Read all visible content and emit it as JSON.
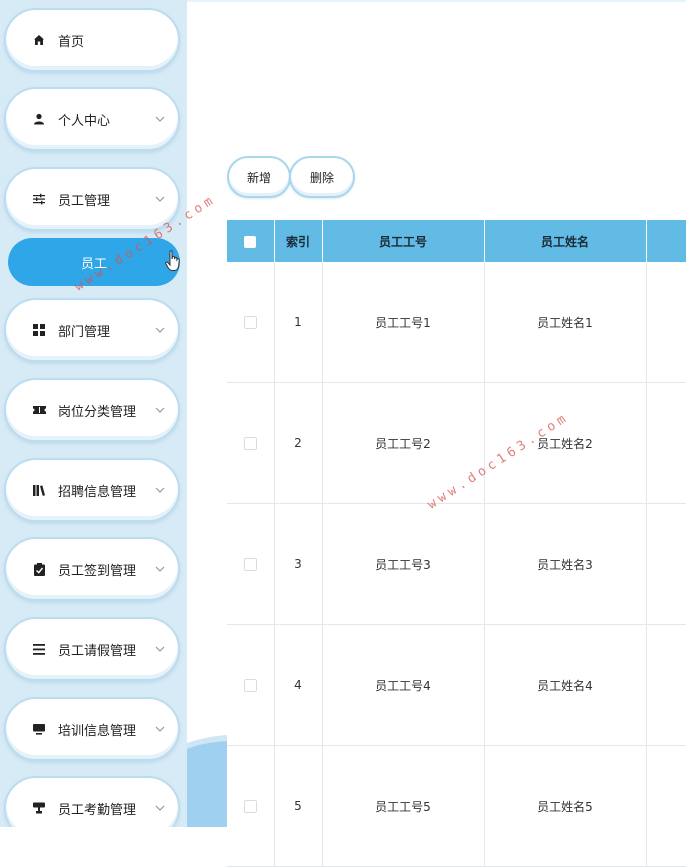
{
  "sidebar": {
    "items": [
      {
        "label": "首页",
        "icon": "home-icon",
        "has_chevron": false
      },
      {
        "label": "个人中心",
        "icon": "user-icon",
        "has_chevron": true
      },
      {
        "label": "员工管理",
        "icon": "sliders-icon",
        "has_chevron": true
      },
      {
        "label": "部门管理",
        "icon": "grid-icon",
        "has_chevron": true
      },
      {
        "label": "岗位分类管理",
        "icon": "ticket-icon",
        "has_chevron": true
      },
      {
        "label": "招聘信息管理",
        "icon": "library-icon",
        "has_chevron": true
      },
      {
        "label": "员工签到管理",
        "icon": "clipboard-check-icon",
        "has_chevron": true
      },
      {
        "label": "员工请假管理",
        "icon": "list-icon",
        "has_chevron": true
      },
      {
        "label": "培训信息管理",
        "icon": "monitor-icon",
        "has_chevron": true
      },
      {
        "label": "员工考勤管理",
        "icon": "trophy-icon",
        "has_chevron": true
      }
    ],
    "submenu_active": "员工"
  },
  "toolbar": {
    "add_label": "新增",
    "delete_label": "删除"
  },
  "table": {
    "headers": [
      "索引",
      "员工工号",
      "员工姓名"
    ],
    "rows": [
      {
        "index": "1",
        "emp_no": "员工工号1",
        "emp_name": "员工姓名1"
      },
      {
        "index": "2",
        "emp_no": "员工工号2",
        "emp_name": "员工姓名2"
      },
      {
        "index": "3",
        "emp_no": "员工工号3",
        "emp_name": "员工姓名3"
      },
      {
        "index": "4",
        "emp_no": "员工工号4",
        "emp_name": "员工姓名4"
      },
      {
        "index": "5",
        "emp_no": "员工工号5",
        "emp_name": "员工姓名5"
      }
    ]
  },
  "watermark": "www.doc163.com",
  "colors": {
    "accent": "#2ea6e8",
    "table_header": "#62bbe5",
    "sidebar_bg": "#d7ebf7",
    "watermark": "#d9534f"
  }
}
